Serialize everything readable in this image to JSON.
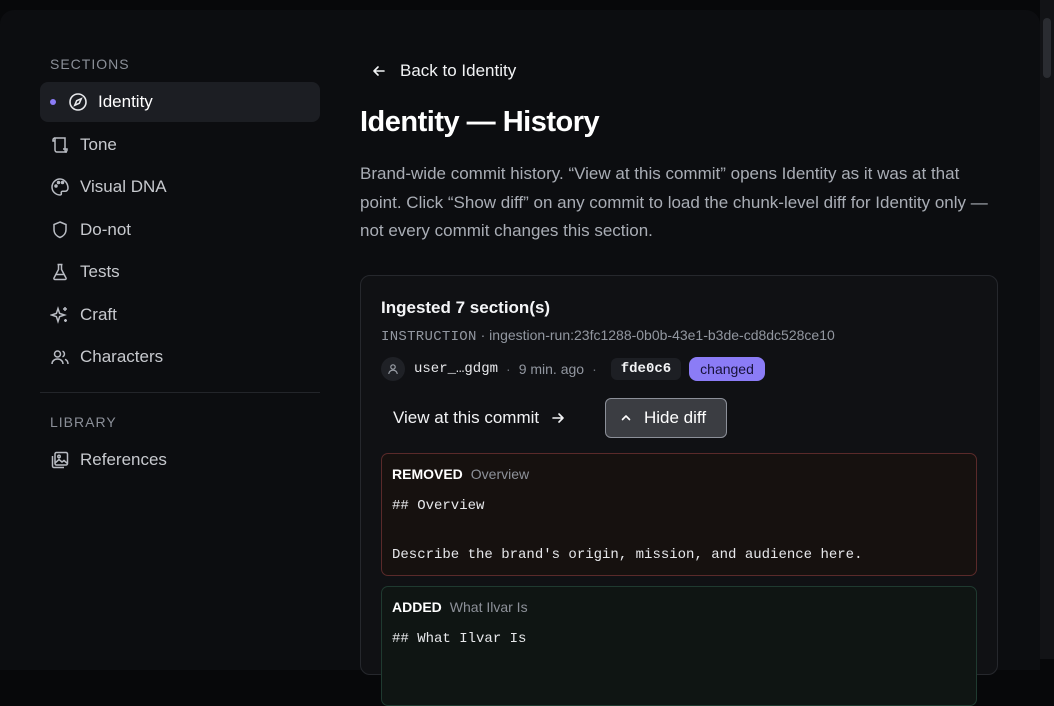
{
  "sidebar": {
    "sections_heading": "SECTIONS",
    "items": [
      {
        "label": "Identity",
        "icon": "compass-icon",
        "active": true
      },
      {
        "label": "Tone",
        "icon": "scroll-icon"
      },
      {
        "label": "Visual DNA",
        "icon": "palette-icon"
      },
      {
        "label": "Do-not",
        "icon": "shield-icon"
      },
      {
        "label": "Tests",
        "icon": "flask-icon"
      },
      {
        "label": "Craft",
        "icon": "sparkles-icon"
      },
      {
        "label": "Characters",
        "icon": "users-icon"
      }
    ],
    "library_heading": "LIBRARY",
    "library_items": [
      {
        "label": "References",
        "icon": "images-icon"
      }
    ]
  },
  "main": {
    "back_label": "Back to Identity",
    "title": "Identity — History",
    "description": "Brand-wide commit history. “View at this commit” opens Identity as it was at that point. Click “Show diff” on any commit to load the chunk-level diff for Identity only — not every commit changes this section.",
    "commit": {
      "title": "Ingested 7 section(s)",
      "type": "INSTRUCTION",
      "meta_separator": "·",
      "run_id": "ingestion-run:23fc1288-0b0b-43e1-b3de-cd8dc528ce10",
      "user": "user_…gdgm",
      "time_ago": "9 min. ago",
      "hash": "fde0c6",
      "badge": "changed",
      "view_label": "View at this commit",
      "hide_label": "Hide diff",
      "diffs": [
        {
          "kind": "REMOVED",
          "section": "Overview",
          "code": "## Overview\n\nDescribe the brand's origin, mission, and audience here."
        },
        {
          "kind": "ADDED",
          "section": "What Ilvar Is",
          "code": "## What Ilvar Is"
        }
      ]
    }
  },
  "colors": {
    "accent": "#8b7cf6",
    "background": "#0c0d10",
    "removed_border": "#5a2a2a",
    "added_border": "#1f3a30"
  }
}
